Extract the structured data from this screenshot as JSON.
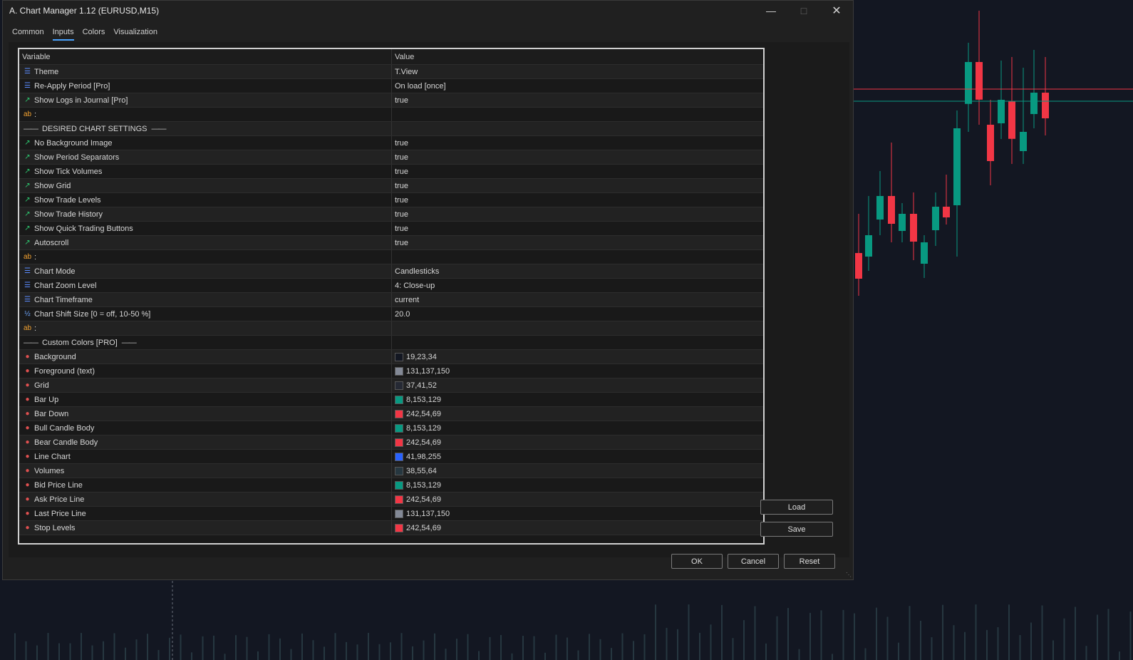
{
  "window": {
    "title": "A. Chart Manager 1.12 (EURUSD,M15)"
  },
  "tabs": [
    {
      "label": "Common",
      "active": false
    },
    {
      "label": "Inputs",
      "active": true
    },
    {
      "label": "Colors",
      "active": false
    },
    {
      "label": "Visualization",
      "active": false
    }
  ],
  "grid": {
    "headers": {
      "variable": "Variable",
      "value": "Value"
    },
    "rows": [
      {
        "type": "enum",
        "name": "Theme",
        "value": "T.View"
      },
      {
        "type": "enum",
        "name": "Re-Apply Period [Pro]",
        "value": "On load [once]"
      },
      {
        "type": "bool",
        "name": "Show Logs in Journal [Pro]",
        "value": "true"
      },
      {
        "type": "str",
        "name": ":",
        "value": ""
      },
      {
        "type": "section",
        "name": "DESIRED CHART SETTINGS",
        "value": ""
      },
      {
        "type": "bool",
        "name": "No Background Image",
        "value": "true"
      },
      {
        "type": "bool",
        "name": "Show Period Separators",
        "value": "true"
      },
      {
        "type": "bool",
        "name": "Show Tick Volumes",
        "value": "true"
      },
      {
        "type": "bool",
        "name": "Show Grid",
        "value": "true"
      },
      {
        "type": "bool",
        "name": "Show Trade Levels",
        "value": "true"
      },
      {
        "type": "bool",
        "name": "Show Trade History",
        "value": "true"
      },
      {
        "type": "bool",
        "name": "Show Quick Trading Buttons",
        "value": "true"
      },
      {
        "type": "bool",
        "name": "Autoscroll",
        "value": "true"
      },
      {
        "type": "str",
        "name": ":",
        "value": ""
      },
      {
        "type": "enum",
        "name": "Chart Mode",
        "value": "Candlesticks"
      },
      {
        "type": "enum",
        "name": "Chart Zoom Level",
        "value": "4: Close-up"
      },
      {
        "type": "enum",
        "name": "Chart Timeframe",
        "value": "current"
      },
      {
        "type": "num",
        "name": "Chart Shift Size [0 = off, 10-50 %]",
        "value": "20.0"
      },
      {
        "type": "str",
        "name": ":",
        "value": ""
      },
      {
        "type": "section",
        "name": "Custom Colors [PRO]",
        "value": ""
      },
      {
        "type": "color",
        "name": "Background",
        "value": "19,23,34",
        "swatch": "#131722"
      },
      {
        "type": "color",
        "name": "Foreground (text)",
        "value": "131,137,150",
        "swatch": "#838996"
      },
      {
        "type": "color",
        "name": "Grid",
        "value": "37,41,52",
        "swatch": "#252934"
      },
      {
        "type": "color",
        "name": "Bar Up",
        "value": "8,153,129",
        "swatch": "#089981"
      },
      {
        "type": "color",
        "name": "Bar Down",
        "value": "242,54,69",
        "swatch": "#f23645"
      },
      {
        "type": "color",
        "name": "Bull Candle Body",
        "value": "8,153,129",
        "swatch": "#089981"
      },
      {
        "type": "color",
        "name": "Bear Candle Body",
        "value": "242,54,69",
        "swatch": "#f23645"
      },
      {
        "type": "color",
        "name": "Line Chart",
        "value": "41,98,255",
        "swatch": "#2962ff"
      },
      {
        "type": "color",
        "name": "Volumes",
        "value": "38,55,64",
        "swatch": "#263740"
      },
      {
        "type": "color",
        "name": "Bid Price Line",
        "value": "8,153,129",
        "swatch": "#089981"
      },
      {
        "type": "color",
        "name": "Ask Price Line",
        "value": "242,54,69",
        "swatch": "#f23645"
      },
      {
        "type": "color",
        "name": "Last Price Line",
        "value": "131,137,150",
        "swatch": "#838996"
      },
      {
        "type": "color",
        "name": "Stop Levels",
        "value": "242,54,69",
        "swatch": "#f23645"
      }
    ]
  },
  "buttons": {
    "load": "Load",
    "save": "Save",
    "ok": "OK",
    "cancel": "Cancel",
    "reset": "Reset"
  },
  "colors": {
    "bull": "#089981",
    "bear": "#f23645",
    "chart_bg": "#131722",
    "grid": "#252934"
  },
  "icons": {
    "enum": "enum-icon",
    "bool": "bool-icon",
    "str": "string-icon",
    "num": "number-icon",
    "color": "color-icon"
  }
}
